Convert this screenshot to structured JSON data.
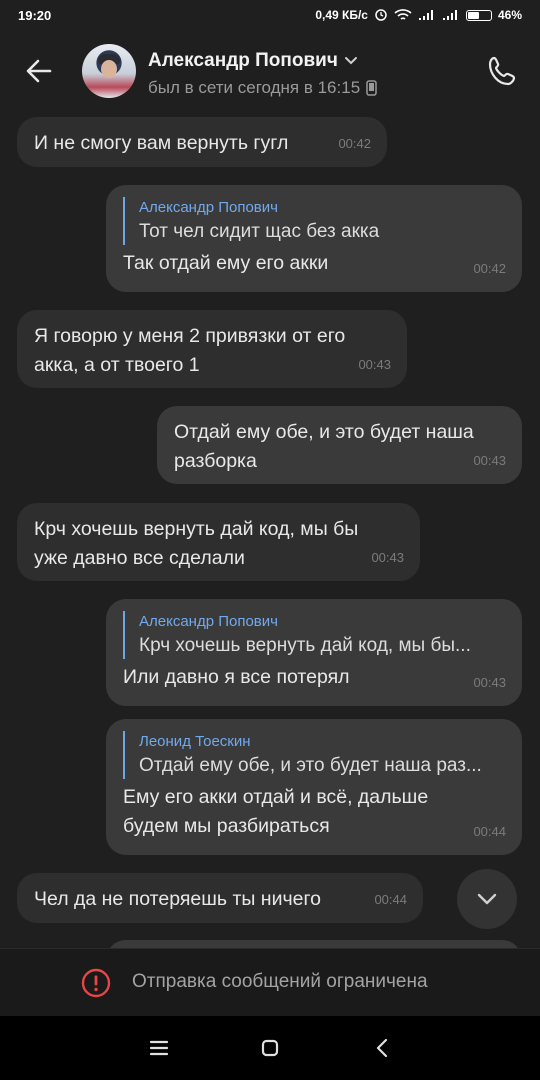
{
  "status_bar": {
    "time": "19:20",
    "speed": "0,49 КБ/с",
    "battery": "46%"
  },
  "header": {
    "contact_name": "Александр Попович",
    "last_seen": "был в сети сегодня в 16:15"
  },
  "messages": [
    {
      "direction": "in",
      "text": "И не смогу вам вернуть гугл",
      "time": "00:42"
    },
    {
      "direction": "out",
      "reply_name": "Александр Попович",
      "reply_text": "Тот чел сидит щас без акка",
      "text": "Так отдай ему его акки",
      "time": "00:42"
    },
    {
      "direction": "in",
      "text_lines": [
        "Я говорю у меня 2 привязки от его",
        "акка, а от твоего 1"
      ],
      "time": "00:43"
    },
    {
      "direction": "out",
      "text_lines": [
        "Отдай ему обе, и это будет наша",
        "разборка"
      ],
      "time": "00:43"
    },
    {
      "direction": "in",
      "text_lines": [
        "Крч хочешь вернуть дай код, мы бы",
        "уже давно все сделали"
      ],
      "time": "00:43"
    },
    {
      "direction": "out",
      "reply_name": "Александр Попович",
      "reply_text": "Крч хочешь вернуть дай код, мы бы...",
      "text": "Или давно я все потерял",
      "time": "00:43"
    },
    {
      "direction": "out",
      "reply_name": "Леонид Тоескин",
      "reply_text": "Отдай ему обе, и это будет наша раз...",
      "text_lines": [
        "Ему его акки отдай и всё, дальше",
        "будем мы разбираться"
      ],
      "time": "00:44"
    },
    {
      "direction": "in",
      "text": "Чел да не потеряешь ты ничего",
      "time": "00:44"
    }
  ],
  "restriction_notice": "Отправка сообщений ограничена",
  "colors": {
    "background": "#1f1f1f",
    "incoming_bubble": "#2e2e2e",
    "outgoing_bubble": "#3a3a3a",
    "reply_accent": "#71a9ec",
    "warning": "#e64646"
  }
}
